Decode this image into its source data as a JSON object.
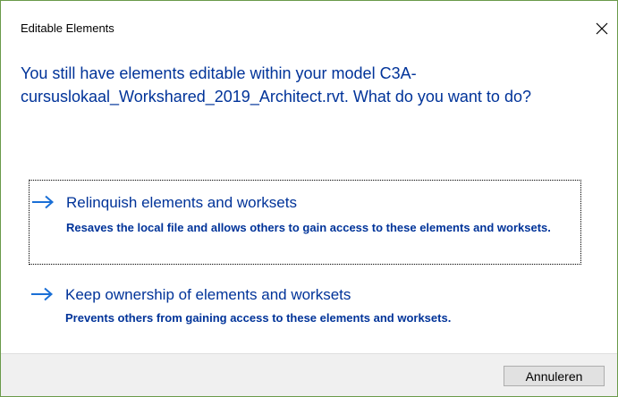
{
  "window": {
    "title": "Editable Elements",
    "close_icon": "close-icon"
  },
  "main_instruction": "You still have elements editable within your model C3A-cursuslokaal_Workshared_2019_Architect.rvt. What do you want to do?",
  "commands": [
    {
      "title": "Relinquish elements and worksets",
      "description": "Resaves the local file and allows others to gain access to these elements and worksets.",
      "icon": "arrow-right-icon",
      "focused": true
    },
    {
      "title": "Keep ownership of elements and worksets",
      "description": "Prevents others from gaining access to these elements and worksets.",
      "icon": "arrow-right-icon",
      "focused": false
    }
  ],
  "footer": {
    "cancel_label": "Annuleren"
  },
  "colors": {
    "accent_text": "#003399",
    "border": "#6a9a4a",
    "footer_bg": "#f0f0f0"
  }
}
